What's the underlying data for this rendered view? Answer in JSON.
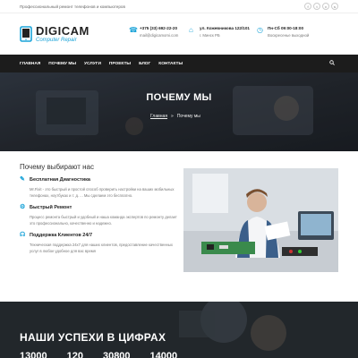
{
  "topbar": {
    "tagline": "Профессиональный ремонт телефонов и компьютеров",
    "socials": [
      {
        "icon": "facebook-icon",
        "glyph": "f"
      },
      {
        "icon": "twitter-icon",
        "glyph": "t"
      },
      {
        "icon": "vk-icon",
        "glyph": "v"
      },
      {
        "icon": "skype-icon",
        "glyph": "s"
      }
    ]
  },
  "logo": {
    "title": "DIGICAM",
    "subtitle": "Computer Repair"
  },
  "contacts": {
    "phone": {
      "line1": "+375 (33) 692-22-20",
      "line2": "mail@digicamomi.com"
    },
    "address": {
      "line1": "ул. Кожевникова 122/101",
      "line2": "г. Минск РБ"
    },
    "hours": {
      "line1": "Пн-Сб 09:00-18:00",
      "line2": "Воскресенье выходной"
    }
  },
  "nav": {
    "items": [
      "ГЛАВНАЯ",
      "ПОЧЕМУ МЫ",
      "УСЛУГИ",
      "ПРОЕКТЫ",
      "БЛОГ",
      "КОНТАКТЫ"
    ]
  },
  "hero": {
    "title": "ПОЧЕМУ МЫ",
    "breadcrumb_home": "Главная",
    "breadcrumb_sep": "»",
    "breadcrumb_current": "Почему мы"
  },
  "why": {
    "heading": "Почему выбирают нас",
    "features": [
      {
        "title": "Бесплатная Диагностика",
        "icon": "wrench-icon",
        "text": "Mr.Fixit - это быстрый и простой способ проверить настройки на ваших мобильных телефонах, ноутбуках и т. д. ... Мы сделаем это бесплатно."
      },
      {
        "title": "Быстрый Ремонт",
        "icon": "gear-icon",
        "text": "Процесс ремонта быстрый и удобный и наша команда экспертов по ремонту делает это профессионально, качественно и надежно."
      },
      {
        "title": "Поддержка Клиентов 24/7",
        "icon": "headset-icon",
        "text": "Техническая поддержка 24x7 для наших клиентов, предоставление качественных услуг в любое удобное для вас время"
      }
    ]
  },
  "stats": {
    "heading": "НАШИ УСПЕХИ В ЦИФРАХ",
    "numbers": [
      "13000",
      "120",
      "30800",
      "14000"
    ]
  },
  "colors": {
    "accent": "#1aa3d8",
    "nav_bg": "#1c1c1c"
  }
}
